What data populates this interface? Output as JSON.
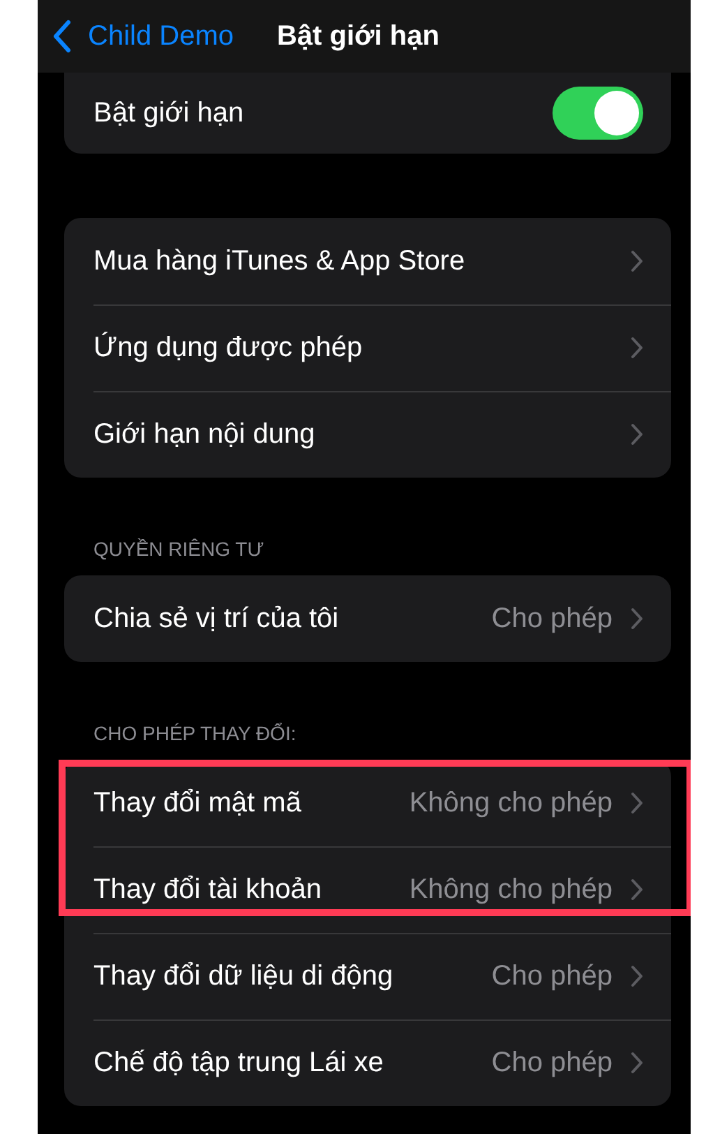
{
  "nav_bar": {
    "back_label": "Child Demo",
    "title": "Bật giới hạn"
  },
  "toggle_row": {
    "label": "Bật giới hạn",
    "on": true
  },
  "groups": [
    {
      "rows": [
        {
          "label": "Mua hàng iTunes & App Store",
          "highlighted": false
        },
        {
          "label": "Ứng dụng được phép",
          "highlighted": false
        },
        {
          "label": "Giới hạn nội dung",
          "highlighted": false
        }
      ]
    },
    {
      "header": "QUYỀN RIÊNG TƯ",
      "rows": [
        {
          "label": "Chia sẻ vị trí của tôi",
          "value": "Cho phép",
          "highlighted": false
        }
      ]
    },
    {
      "header": "CHO PHÉP THAY ĐỔI:",
      "rows": [
        {
          "label": "Thay đổi mật mã",
          "value": "Không cho phép",
          "highlighted": true
        },
        {
          "label": "Thay đổi tài khoản",
          "value": "Không cho phép",
          "highlighted": true
        },
        {
          "label": "Thay đổi dữ liệu di động",
          "value": "Cho phép",
          "highlighted": false
        },
        {
          "label": "Chế độ tập trung Lái xe",
          "value": "Cho phép",
          "highlighted": false
        }
      ]
    }
  ]
}
